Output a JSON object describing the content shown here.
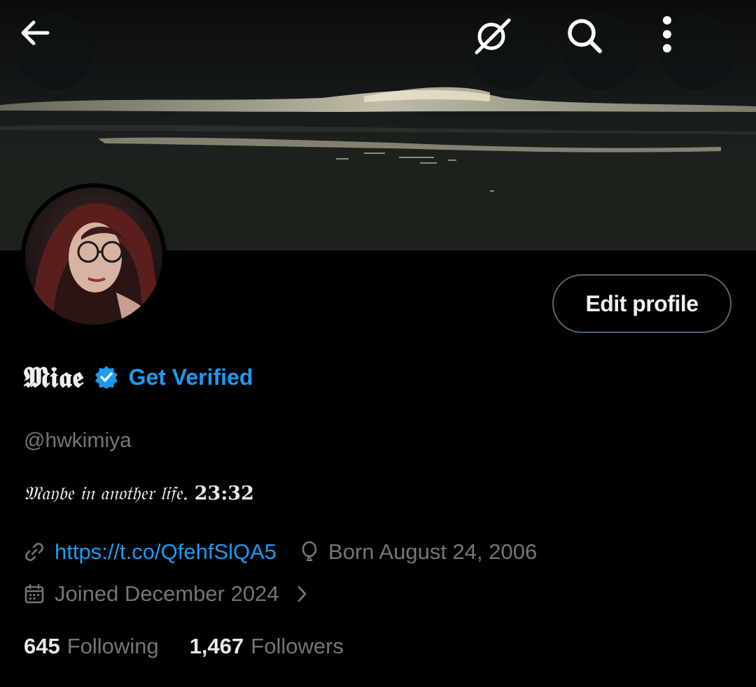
{
  "header": {
    "back_icon": "arrow-left-icon",
    "grok_icon": "grok-icon",
    "search_icon": "search-icon",
    "more_icon": "more-vertical-icon"
  },
  "profile": {
    "display_name": "𝕸𝖎𝖆𝖊",
    "get_verified_label": "Get Verified",
    "handle": "@hwkimiya",
    "bio_text": "𝔐𝔞𝔶𝔟𝔢 𝔦𝔫 𝔞𝔫𝔬𝔱𝔥𝔢𝔯 𝔩𝔦𝔣𝔢.",
    "bio_time": "𝟐𝟑:𝟑𝟐",
    "edit_profile_label": "Edit profile",
    "link": "https://t.co/QfehfSlQA5",
    "birthday": "Born August 24, 2006",
    "joined": "Joined December 2024",
    "following_count": "645",
    "following_label": "Following",
    "followers_count": "1,467",
    "followers_label": "Followers"
  },
  "colors": {
    "accent": "#1d9bf0",
    "muted": "#71767b",
    "background": "#000000"
  }
}
